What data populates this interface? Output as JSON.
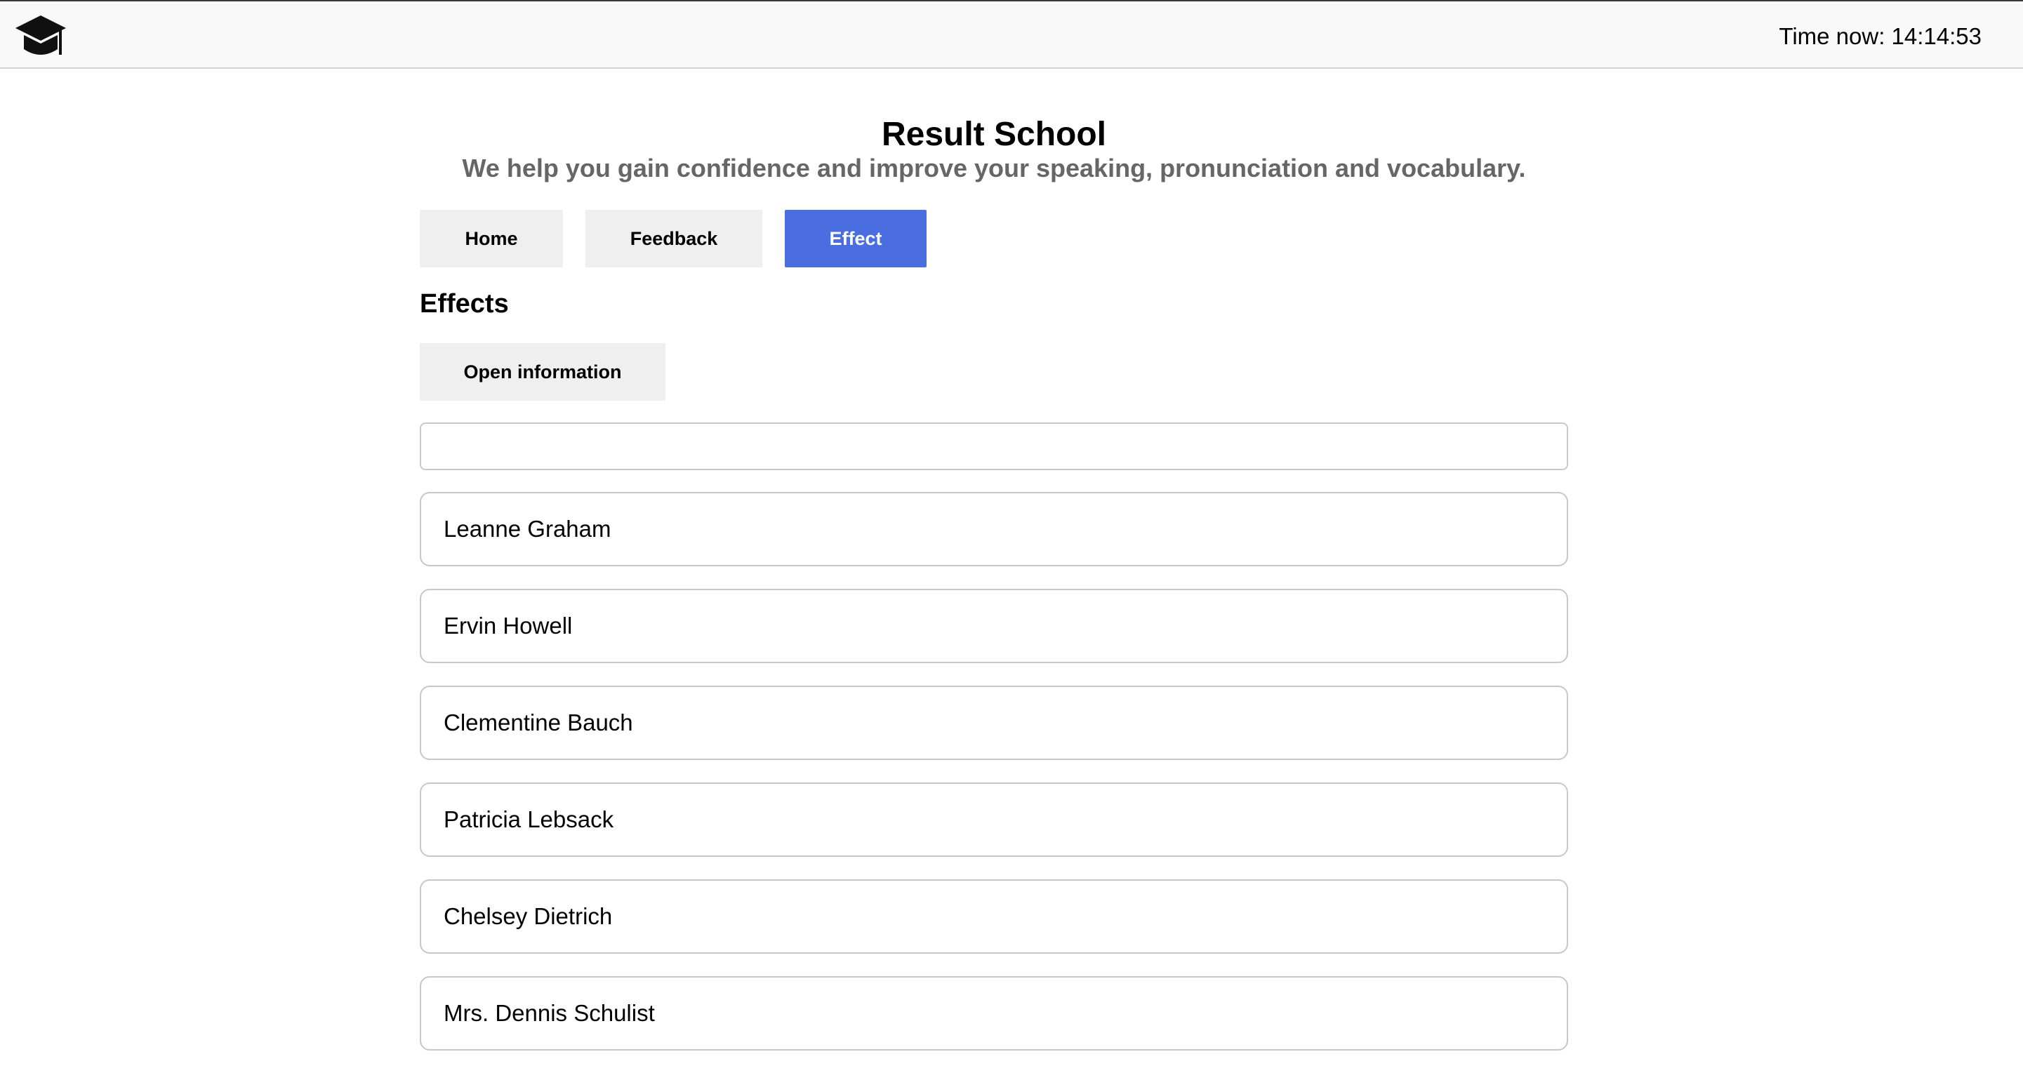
{
  "header": {
    "logo_icon": "graduation-cap-icon",
    "clock_text": "Time now: 14:14:53"
  },
  "hero": {
    "title": "Result School",
    "subtitle": "We help you gain confidence and improve your speaking, pronunciation and vocabulary."
  },
  "nav": {
    "items": [
      {
        "label": "Home",
        "active": false
      },
      {
        "label": "Feedback",
        "active": false
      },
      {
        "label": "Effect",
        "active": true
      }
    ],
    "active_color": "#4a6ee0",
    "inactive_color": "#efefef"
  },
  "effects": {
    "title": "Effects",
    "open_button_label": "Open information",
    "search_value": "",
    "users": [
      "Leanne Graham",
      "Ervin Howell",
      "Clementine Bauch",
      "Patricia Lebsack",
      "Chelsey Dietrich",
      "Mrs. Dennis Schulist"
    ]
  }
}
